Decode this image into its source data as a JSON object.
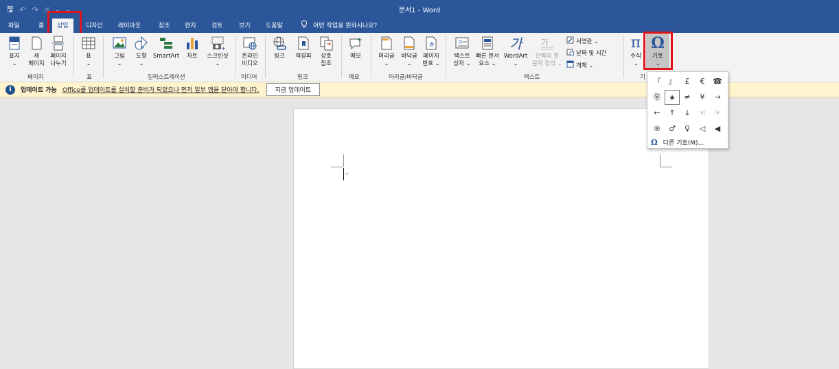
{
  "window": {
    "title": "문서1  -  Word"
  },
  "qat": {
    "save": "🖫",
    "undo": "↶",
    "redo": "↷",
    "touch": "☝",
    "dropdown": "⌄",
    "customize": "⌄"
  },
  "tabs": [
    {
      "label": "파일"
    },
    {
      "label": "홈"
    },
    {
      "label": "삽입"
    },
    {
      "label": "디자인"
    },
    {
      "label": "레이아웃"
    },
    {
      "label": "참조"
    },
    {
      "label": "편지"
    },
    {
      "label": "검토"
    },
    {
      "label": "보기"
    },
    {
      "label": "도움말"
    }
  ],
  "tellme": {
    "icon": "💡",
    "text": "어떤 작업을 원하시나요?"
  },
  "ribbon": {
    "pages": {
      "cover": "표지\n⌄",
      "blank": "새\n페이지",
      "break": "페이지\n나누기",
      "group": "페이지"
    },
    "tables": {
      "table": "표\n⌄",
      "group": "표"
    },
    "illustrations": {
      "picture": "그림\n⌄",
      "shapes": "도형\n⌄",
      "smartart": "SmartArt",
      "chart": "차트",
      "screenshot": "스크린샷\n⌄",
      "group": "일러스트레이션"
    },
    "media": {
      "online_video": "온라인\n비디오",
      "group": "미디어"
    },
    "links": {
      "link": "링크",
      "bookmark": "책갈피",
      "crossref": "상호\n참조",
      "group": "링크"
    },
    "comments": {
      "comment": "메모",
      "group": "메모"
    },
    "headerfooter": {
      "header": "머리글\n⌄",
      "footer": "바닥글\n⌄",
      "pagenum": "페이지\n번호 ⌄",
      "group": "머리글/바닥글"
    },
    "text": {
      "textbox": "텍스트\n상자 ⌄",
      "quickparts": "빠른 문서\n요소 ⌄",
      "wordart": "WordArt\n⌄",
      "dropcap": "단락의 첫\n문자 장식 ⌄",
      "signature": "서명란  ⌄",
      "datetime": "날짜 및 시간",
      "object": "개체  ⌄",
      "group": "텍스트"
    },
    "symbols": {
      "equation": "수식\n⌄",
      "symbol": "기호\n⌄",
      "group": "기"
    }
  },
  "infobar": {
    "title": "업데이트 가능",
    "message": "Office를 업데이트를 설치할 준비가 되었으나 먼저 일부 앱을 닫아야 합니다.",
    "button": "지금 업데이트"
  },
  "symbol_menu": {
    "symbols": [
      "『",
      "』",
      "£",
      "€",
      "☎",
      "㉾",
      "★",
      "≠",
      "¥",
      "→",
      "←",
      "↑",
      "↓",
      "☜",
      "☞",
      "®",
      "♂",
      "♀",
      "◁",
      "◀"
    ],
    "selected_index": 6,
    "more_symbols": "다른 기호(M)..."
  },
  "colors": {
    "titlebar": "#2b579a",
    "ribbon": "#f3f3f3",
    "infobar": "#fff4ce",
    "highlight": "#e0141b"
  }
}
